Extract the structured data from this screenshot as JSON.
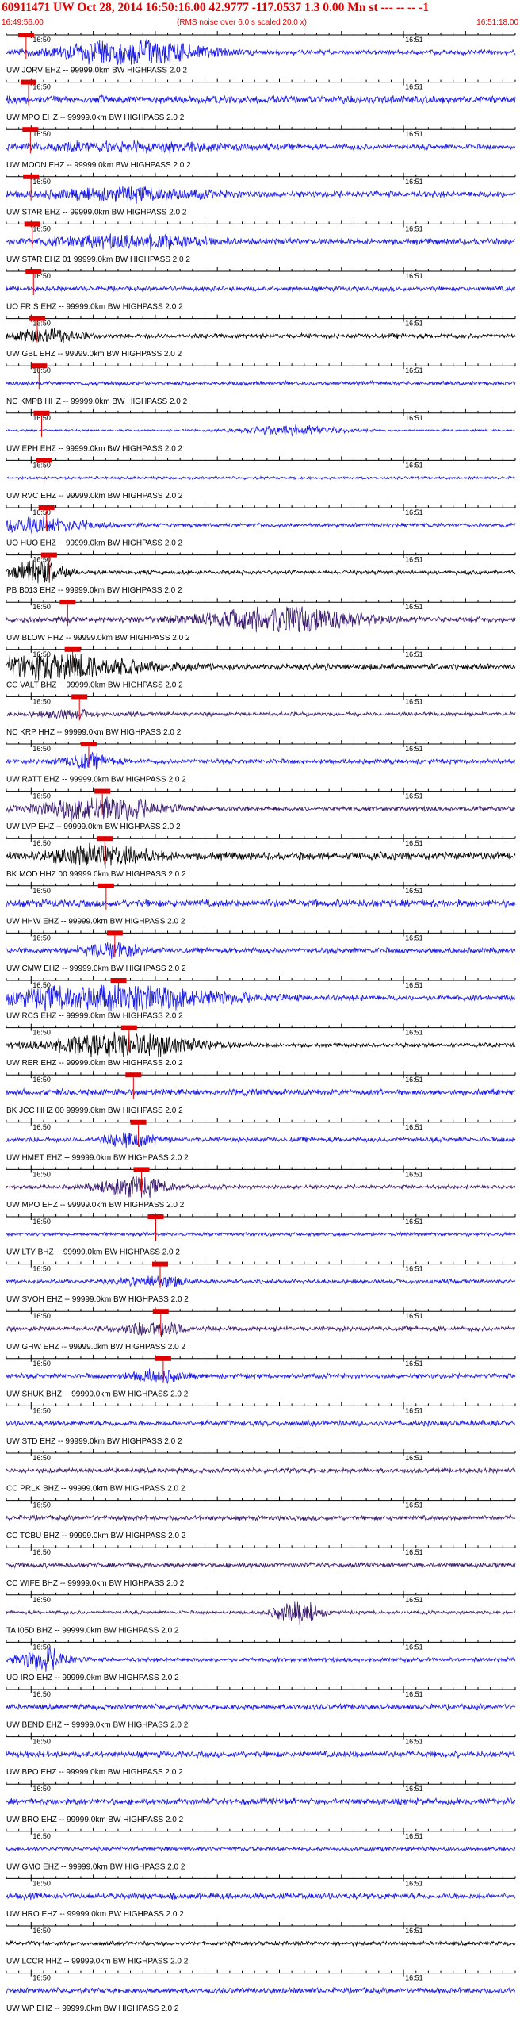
{
  "header": {
    "title": "60911471 UW Oct 28, 2014 16:50:16.00   42.9777 -117.0537  1.3 0.00 Mn st --- -- --  -1",
    "start_time": "16:49:56.00",
    "scale_note": "(RMS noise over 6.0 s scaled 20.0 x)",
    "end_time": "16:51:18.00"
  },
  "chart_data": {
    "type": "line",
    "title": "60911471 UW Oct 28, 2014 16:50:16.00   42.9777 -117.0537  1.3 0.00 Mn st --- -- --  -1",
    "x_range": [
      "16:49:56.00",
      "16:51:18.00"
    ],
    "tick_labels": [
      "16:50",
      "16:51"
    ],
    "tick_seconds": [
      4,
      64
    ],
    "total_seconds": 82,
    "colors": {
      "blue": "#1a1ae6",
      "black": "#000000",
      "purple": "#3a1a6e",
      "pick": "#e00000",
      "axis": "#000000"
    },
    "traces": [
      {
        "label": "UW JORV EHZ -- 99999.0km BW HIGHPASS  2.0  2",
        "color": "blue",
        "pick": 1.9,
        "burst": [
          20,
          0.55,
          0.95
        ],
        "bg": 0.35
      },
      {
        "label": "UW MPO EHZ -- 99999.0km BW HIGHPASS  2.0  2",
        "color": "blue",
        "pick": 2.3,
        "burst": null,
        "bg": 0.55
      },
      {
        "label": "UW MOON EHZ -- 99999.0km BW HIGHPASS  2.0  2",
        "color": "blue",
        "pick": 2.6,
        "burst": [
          20,
          0.92,
          0.3
        ],
        "bg": 0.4
      },
      {
        "label": "UW STAR EHZ -- 99999.0km BW HIGHPASS  2.0  2",
        "color": "blue",
        "pick": 2.7,
        "burst": [
          20,
          0.6,
          0.4
        ],
        "bg": 0.45
      },
      {
        "label": "UW STAR EHZ 01 99999.0km BW HIGHPASS  2.0  2",
        "color": "blue",
        "pick": 2.9,
        "burst": [
          20,
          0.6,
          0.4
        ],
        "bg": 0.45
      },
      {
        "label": "UO FRIS EHZ -- 99999.0km BW HIGHPASS  2.0  2",
        "color": "blue",
        "pick": 3.1,
        "burst": null,
        "bg": 0.35
      },
      {
        "label": "UW GBL EHZ -- 99999.0km BW HIGHPASS  2.0  2",
        "color": "black",
        "pick": 3.7,
        "burst": [
          6,
          0.15,
          0.5
        ],
        "bg": 0.35
      },
      {
        "label": "NC KMPB HHZ -- 99999.0km BW HIGHPASS  2.0  2",
        "color": "blue",
        "pick": 4.0,
        "burst": null,
        "bg": 0.3
      },
      {
        "label": "UW EPH EHZ -- 99999.0km BW HIGHPASS  2.0  2",
        "color": "blue",
        "pick": 4.4,
        "burst": [
          46,
          0.3,
          0.4
        ],
        "bg": 0.15
      },
      {
        "label": "UW RVC EHZ -- 99999.0km BW HIGHPASS  2.0  2",
        "color": "blue",
        "pick": 4.8,
        "burst": null,
        "bg": 0.2
      },
      {
        "label": "UO HUO EHZ -- 99999.0km BW HIGHPASS  2.0  2",
        "color": "blue",
        "pick": 5.2,
        "burst": [
          5,
          0.35,
          0.5
        ],
        "bg": 0.3
      },
      {
        "label": "PB B013 EHZ -- 99999.0km BW HIGHPASS  2.0  2",
        "color": "black",
        "pick": 5.6,
        "burst": [
          5,
          0.05,
          0.9
        ],
        "bg": 0.3
      },
      {
        "label": "UW BLOW HHZ -- 99999.0km BW HIGHPASS  2.0  2",
        "color": "purple",
        "pick": 8.6,
        "burst": [
          45,
          0.6,
          0.95
        ],
        "bg": 0.4
      },
      {
        "label": "CC VALT BHZ -- 99999.0km BW HIGHPASS  2.0  2",
        "color": "black",
        "pick": 9.4,
        "burst": [
          8,
          0.7,
          0.9
        ],
        "bg": 0.45
      },
      {
        "label": "NC KRP HHZ -- 99999.0km BW HIGHPASS  2.0  2",
        "color": "purple",
        "pick": 10.5,
        "burst": [
          10,
          0.05,
          0.3
        ],
        "bg": 0.3
      },
      {
        "label": "UW RATT EHZ -- 99999.0km BW HIGHPASS  2.0  2",
        "color": "blue",
        "pick": 12.0,
        "burst": [
          13,
          0.05,
          0.5
        ],
        "bg": 0.35
      },
      {
        "label": "UW LVP EHZ -- 99999.0km BW HIGHPASS  2.0  2",
        "color": "purple",
        "pick": 14.2,
        "burst": [
          15,
          0.4,
          0.95
        ],
        "bg": 0.35
      },
      {
        "label": "BK MOD HHZ 00 99999.0km BW HIGHPASS  2.0  2",
        "color": "black",
        "pick": 14.6,
        "burst": [
          15,
          0.3,
          0.7
        ],
        "bg": 0.55
      },
      {
        "label": "UW HHW EHZ -- 99999.0km BW HIGHPASS  2.0  2",
        "color": "blue",
        "pick": 14.8,
        "burst": null,
        "bg": 0.55
      },
      {
        "label": "UW CMW EHZ -- 99999.0km BW HIGHPASS  2.0  2",
        "color": "blue",
        "pick": 16.2,
        "burst": [
          17,
          0.1,
          0.5
        ],
        "bg": 0.4
      },
      {
        "label": "UW RCS EHZ -- 99999.0km BW HIGHPASS  2.0  2",
        "color": "blue",
        "pick": 16.8,
        "burst": [
          17,
          1.0,
          0.95
        ],
        "bg": 0.4
      },
      {
        "label": "UW RER EHZ -- 99999.0km BW HIGHPASS  2.0  2",
        "color": "black",
        "pick": 18.5,
        "burst": [
          19,
          0.55,
          0.95
        ],
        "bg": 0.3
      },
      {
        "label": "BK JCC HHZ 00 99999.0km BW HIGHPASS  2.0  2",
        "color": "blue",
        "pick": 19.2,
        "burst": null,
        "bg": 0.45
      },
      {
        "label": "UW HMET EHZ -- 99999.0km BW HIGHPASS  2.0  2",
        "color": "blue",
        "pick": 20.0,
        "burst": [
          20,
          0.05,
          0.5
        ],
        "bg": 0.35
      },
      {
        "label": "UW MPO EHZ -- 99999.0km BW HIGHPASS  2.0  2",
        "color": "purple",
        "pick": 20.5,
        "burst": [
          -2,
          0.15,
          0.7
        ],
        "bg": 0.3
      },
      {
        "label": "UW LTY BHZ -- 99999.0km BW HIGHPASS  2.0  2",
        "color": "blue",
        "pick": 22.8,
        "burst": null,
        "bg": 0.25
      },
      {
        "label": "UW SVOH EHZ -- 99999.0km BW HIGHPASS  2.0  2",
        "color": "blue",
        "pick": 23.5,
        "burst": [
          24,
          0.1,
          0.4
        ],
        "bg": 0.3
      },
      {
        "label": "UW GHW EHZ -- 99999.0km BW HIGHPASS  2.0  2",
        "color": "purple",
        "pick": 23.6,
        "burst": [
          24,
          0.12,
          0.5
        ],
        "bg": 0.35
      },
      {
        "label": "UW SHUK BHZ -- 99999.0km BW HIGHPASS  2.0  2",
        "color": "blue",
        "pick": 24.0,
        "burst": [
          24,
          0.08,
          0.4
        ],
        "bg": 0.35
      },
      {
        "label": "UW STD EHZ -- 99999.0km BW HIGHPASS  2.0  2",
        "color": "blue",
        "pick": null,
        "burst": null,
        "bg": 0.4
      },
      {
        "label": "CC PRLK BHZ -- 99999.0km BW HIGHPASS  2.0  2",
        "color": "purple",
        "pick": null,
        "burst": null,
        "bg": 0.35
      },
      {
        "label": "CC TCBU BHZ -- 99999.0km BW HIGHPASS  2.0  2",
        "color": "purple",
        "pick": null,
        "burst": null,
        "bg": 0.35
      },
      {
        "label": "CC WIFE BHZ -- 99999.0km BW HIGHPASS  2.0  2",
        "color": "purple",
        "pick": null,
        "burst": null,
        "bg": 0.35
      },
      {
        "label": "TA I05D BHZ -- 99999.0km BW HIGHPASS  2.0  2",
        "color": "purple",
        "pick": null,
        "burst": [
          47,
          0.02,
          0.8
        ],
        "bg": 0.25
      },
      {
        "label": "UO IRO EHZ -- 99999.0km BW HIGHPASS  2.0  2",
        "color": "blue",
        "pick": null,
        "burst": [
          6,
          0.05,
          0.8
        ],
        "bg": 0.3
      },
      {
        "label": "UW BEND EHZ -- 99999.0km BW HIGHPASS  2.0  2",
        "color": "blue",
        "pick": null,
        "burst": null,
        "bg": 0.4
      },
      {
        "label": "UW BPO EHZ -- 99999.0km BW HIGHPASS  2.0  2",
        "color": "blue",
        "pick": null,
        "burst": null,
        "bg": 0.45
      },
      {
        "label": "UW BRO EHZ -- 99999.0km BW HIGHPASS  2.0  2",
        "color": "blue",
        "pick": null,
        "burst": null,
        "bg": 0.45
      },
      {
        "label": "UW GMO EHZ -- 99999.0km BW HIGHPASS  2.0  2",
        "color": "blue",
        "pick": null,
        "burst": null,
        "bg": 0.3
      },
      {
        "label": "UW HRO EHZ -- 99999.0km BW HIGHPASS  2.0  2",
        "color": "blue",
        "pick": null,
        "burst": null,
        "bg": 0.45
      },
      {
        "label": "UW LCCR HHZ -- 99999.0km BW HIGHPASS  2.0  2",
        "color": "black",
        "pick": null,
        "burst": null,
        "bg": 0.3
      },
      {
        "label": "UW WP EHZ -- 99999.0km BW HIGHPASS  2.0  2",
        "color": "blue",
        "pick": null,
        "burst": null,
        "bg": 0.4
      }
    ]
  }
}
